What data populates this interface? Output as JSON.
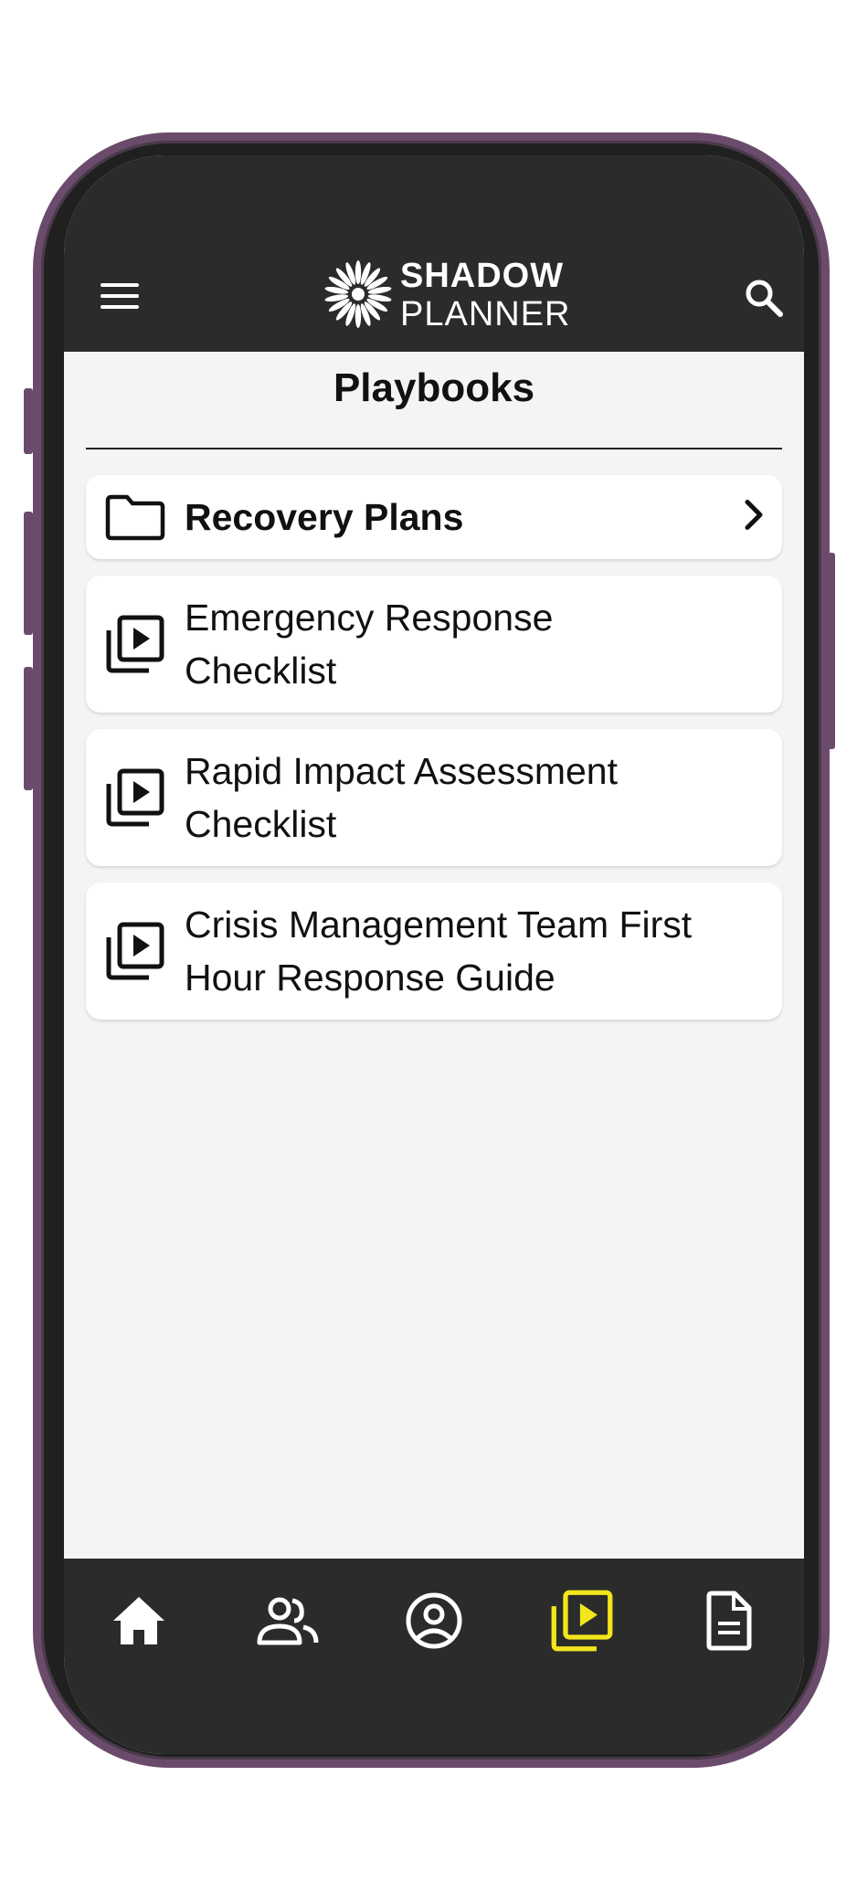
{
  "header": {
    "logo_line1": "SHADOW",
    "logo_line2": "PLANNER",
    "menu_icon": "menu-icon",
    "search_icon": "search-icon"
  },
  "page": {
    "title": "Playbooks"
  },
  "items": [
    {
      "label": "Recovery Plans",
      "type": "folder",
      "icon": "folder-icon"
    },
    {
      "label": "Emergency Response Checklist",
      "type": "playbook",
      "icon": "video-library-icon"
    },
    {
      "label": "Rapid Impact Assessment Checklist",
      "type": "playbook",
      "icon": "video-library-icon"
    },
    {
      "label": "Crisis Management Team First Hour Response Guide",
      "type": "playbook",
      "icon": "video-library-icon"
    }
  ],
  "bottom_nav": [
    {
      "icon": "home-icon",
      "active": false
    },
    {
      "icon": "people-icon",
      "active": false
    },
    {
      "icon": "account-circle-icon",
      "active": false
    },
    {
      "icon": "video-library-icon",
      "active": true
    },
    {
      "icon": "document-icon",
      "active": false
    }
  ],
  "colors": {
    "header": "#2b2b2b",
    "accent": "#f2e51c",
    "frame": "#6b4b6b",
    "background": "#f3f4f6"
  }
}
